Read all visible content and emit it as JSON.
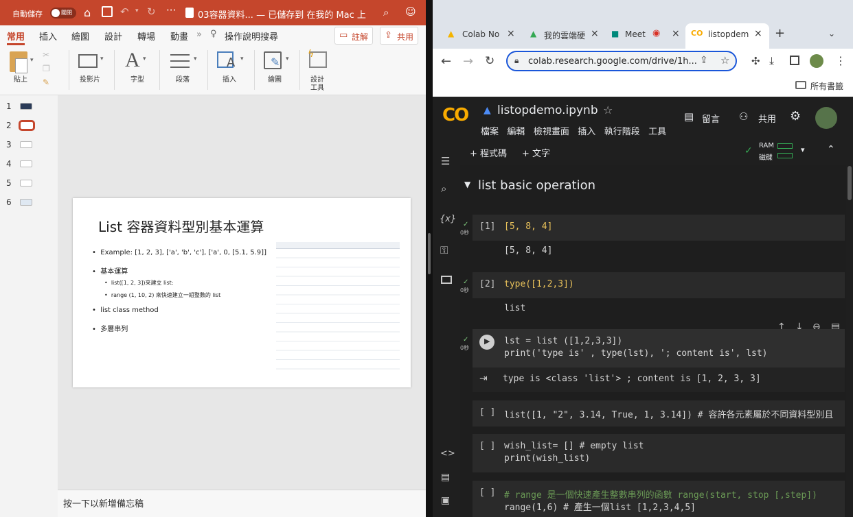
{
  "ppt": {
    "autosave_label": "自動儲存",
    "autosave_state": "關閉",
    "doc_title": "03容器資料... — 已儲存到 在我的 Mac 上",
    "tabs": [
      "常用",
      "插入",
      "繪圖",
      "設計",
      "轉場",
      "動畫"
    ],
    "tell_me": "操作說明搜尋",
    "comment_button": "註解",
    "share_button": "共用",
    "ribbon": {
      "paste": "貼上",
      "slides": "投影片",
      "font": "字型",
      "paragraph": "段落",
      "insert": "插入",
      "drawing": "繪圖",
      "design_tools_1": "設計",
      "design_tools_2": "工具"
    },
    "thumbnails": [
      "1",
      "2",
      "3",
      "4",
      "5",
      "6"
    ],
    "slide": {
      "title": "List 容器資料型別基本運算",
      "bullets": [
        "Example: [1, 2, 3], ['a', 'b', 'c'], ['a', 0, [5.1, 5.9]]",
        "基本運算",
        "list([1, 2, 3])來建立 list:",
        "range (1, 10, 2) 來快速建立一組整數的 list",
        "list class method",
        "多層串列"
      ]
    },
    "notes_placeholder": "按一下以新增備忘稿"
  },
  "chrome": {
    "tabs": [
      "Colab No",
      "我的雲端硬",
      "Meet",
      "listopdem"
    ],
    "new_tab": "+",
    "url": "colab.research.google.com/drive/1h...",
    "bookmarks_folder": "所有書籤"
  },
  "colab": {
    "logo": "CO",
    "notebook_title": "listopdemo.ipynb",
    "menu": [
      "檔案",
      "編輯",
      "檢視畫面",
      "插入",
      "執行階段",
      "工具"
    ],
    "comment": "留言",
    "share": "共用",
    "add_code": "+ 程式碼",
    "add_text": "+ 文字",
    "ram": "RAM",
    "disk": "磁碟",
    "section_title": "list basic operation",
    "cells": [
      {
        "prompt": "[1]",
        "time": "0秒",
        "code": "[5, 8, 4]",
        "output": "[5, 8, 4]"
      },
      {
        "prompt": "[2]",
        "time": "0秒",
        "code": "type([1,2,3])",
        "output": "list"
      },
      {
        "prompt": "",
        "time": "0秒",
        "code_line1": "lst = list ([1,2,3,3])",
        "code_line2": "print('type is' , type(lst), '; content is', lst)",
        "output": "type is <class 'list'> ; content is [1, 2, 3, 3]"
      },
      {
        "prompt": "[ ]",
        "code": "list([1, \"2\", 3.14, True, 1, 3.14]) # 容許各元素屬於不同資料型別且"
      },
      {
        "prompt": "[ ]",
        "code_line1": "wish_list= [] # empty list",
        "code_line2": "print(wish_list)"
      },
      {
        "prompt": "[ ]",
        "code_line1": "# range 是一個快速產生整數串列的函數 range(start, stop [,step])",
        "code_line2": "range(1,6) # 產生一個list [1,2,3,4,5]"
      }
    ]
  }
}
